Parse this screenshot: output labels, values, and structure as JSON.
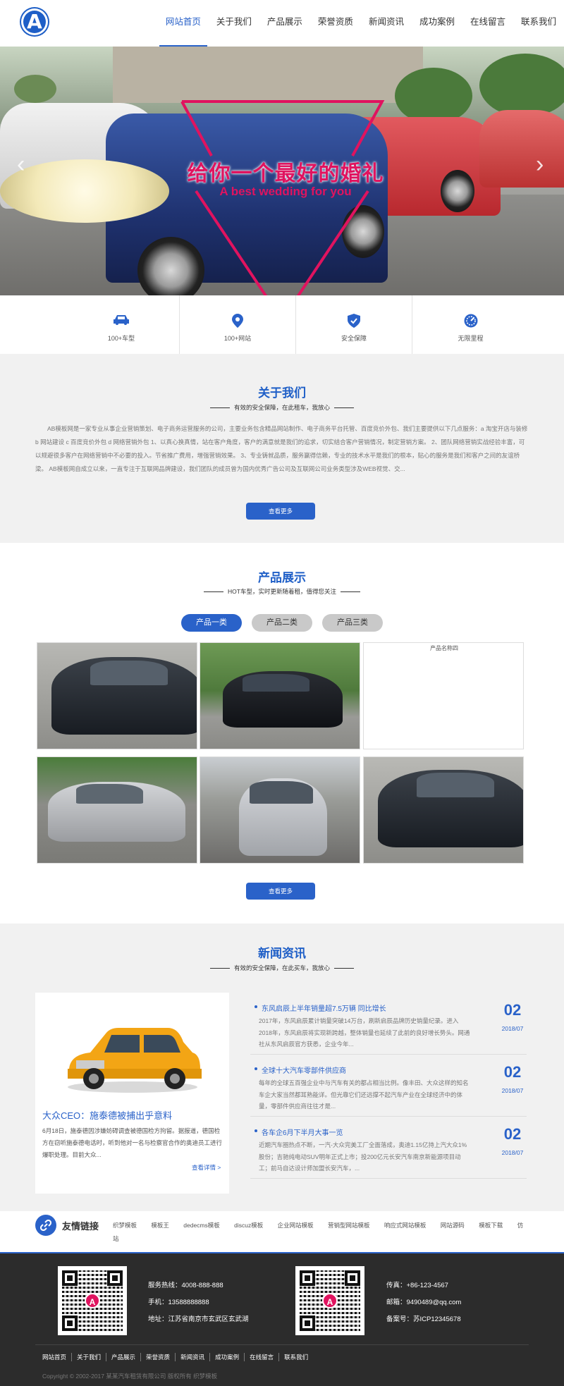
{
  "header": {
    "logo_letter": "A",
    "nav": [
      "网站首页",
      "关于我们",
      "产品展示",
      "荣誉资质",
      "新闻资讯",
      "成功案例",
      "在线留言",
      "联系我们"
    ],
    "active_index": 0
  },
  "banner": {
    "title": "给你一个最好的婚礼",
    "subtitle": "A best wedding for you",
    "prev": "‹",
    "next": "›"
  },
  "features": [
    {
      "icon": "car-icon",
      "label": "100+车型"
    },
    {
      "icon": "location-icon",
      "label": "100+网站"
    },
    {
      "icon": "shield-icon",
      "label": "安全保障"
    },
    {
      "icon": "speedometer-icon",
      "label": "无限里程"
    }
  ],
  "about": {
    "title": "关于我们",
    "subtitle": "有效的安全保障，在此租车，我放心",
    "text": "AB模板网是一家专业从事企业营销策划、电子商务运营服务的公司，主要业务包含精品网站制作、电子商务平台托管、百度竞价外包、我们主要提供以下几点服务：a 淘宝开店与装修 b 网站建设 c 百度竞价外包 d 网络营销外包 1、以真心换真情，站在客户角度，客户的满意就是我们的追求，切实结合客户营销情况，制定营销方案。 2、团队网络营销实战经验丰富，可以规避很多客户在网络营销中不必要的投入。节省推广费用，增强营销效果。 3、专业铸就品质，服务赢得信赖，专业的技术水平是我们的根本，贴心的服务是我们和客户之间的友谊桥梁。 AB模板网自成立以来，一直专注于互联网品牌建设，我们团队的成员曾为国内优秀广告公司及互联网公司业务类型涉及WEB视觉、交...",
    "more": "查看更多"
  },
  "products": {
    "title": "产品展示",
    "subtitle": "HOT车型，实时更新随着租，值得您关注",
    "tabs": [
      "产品一类",
      "产品二类",
      "产品三类"
    ],
    "active_tab": 0,
    "broken_alt": "产品名称四",
    "more": "查看更多"
  },
  "news": {
    "title": "新闻资讯",
    "subtitle": "有效的安全保障，在此买车，我放心",
    "featured": {
      "title": "大众CEO：施泰德被捕出乎意料",
      "desc": "6月18日，施泰德因涉嫌妨碍调查被德国检方拘留。据报道，德国检方在窃听施泰德电话时，听到他对一名与检察官合作的奥迪员工进行爆职处理。目前大众...",
      "more": "查看详情 >"
    },
    "items": [
      {
        "title": "东风启辰上半年销量超7.5万辆 同比增长",
        "desc": "2017年，东风启辰累计销量突破14万台，刷新启辰品牌历史销量纪录。进入2018年，东风启辰将实现新跨越，整体销量也延续了此前的良好增长势头。网通社从东风启辰官方获悉，企业今年...",
        "day": "02",
        "ym": "2018/07"
      },
      {
        "title": "全球十大汽车零部件供应商",
        "desc": "每年的全球五百强企业中与汽车有关的都占相当比例。像丰田、大众这样的知名车企大家当然都耳熟能详。但光靠它们还远撑不起汽车产业在全球经济中的体量，零部件供应商往往才是...",
        "day": "02",
        "ym": "2018/07"
      },
      {
        "title": "各车企6月下半月大事一览",
        "desc": "近期汽车圈热点不断，一汽-大众完美工厂全面落成，奥迪1.15亿持上汽大众1%股份；吉驰纯电动SUV明年正式上市；投200亿元长安汽车南京新能源项目动工；前马自达设计师加盟长安汽车，...",
        "day": "02",
        "ym": "2018/07"
      }
    ]
  },
  "links": {
    "icon": "link-icon",
    "title": "友情链接",
    "items": [
      "织梦模板",
      "模板王",
      "dedecms模板",
      "discuz模板",
      "企业网站模板",
      "营销型网站模板",
      "响应式网站模板",
      "网站源码",
      "模板下载",
      "仿站"
    ]
  },
  "footer": {
    "left": [
      "服务热线：4008-888-888",
      "手机：13588888888",
      "地址：江苏省南京市玄武区玄武湖"
    ],
    "right": [
      "传真：+86-123-4567",
      "邮箱：9490489@qq.com",
      "备案号：苏ICP12345678"
    ],
    "nav": [
      "网站首页",
      "关于我们",
      "产品展示",
      "荣誉资质",
      "新闻资讯",
      "成功案例",
      "在线留言",
      "联系我们"
    ],
    "copyright": "Copyright © 2002-2017 某某汽车租赁有限公司 版权所有 织梦模板",
    "qr_logo": "A"
  }
}
